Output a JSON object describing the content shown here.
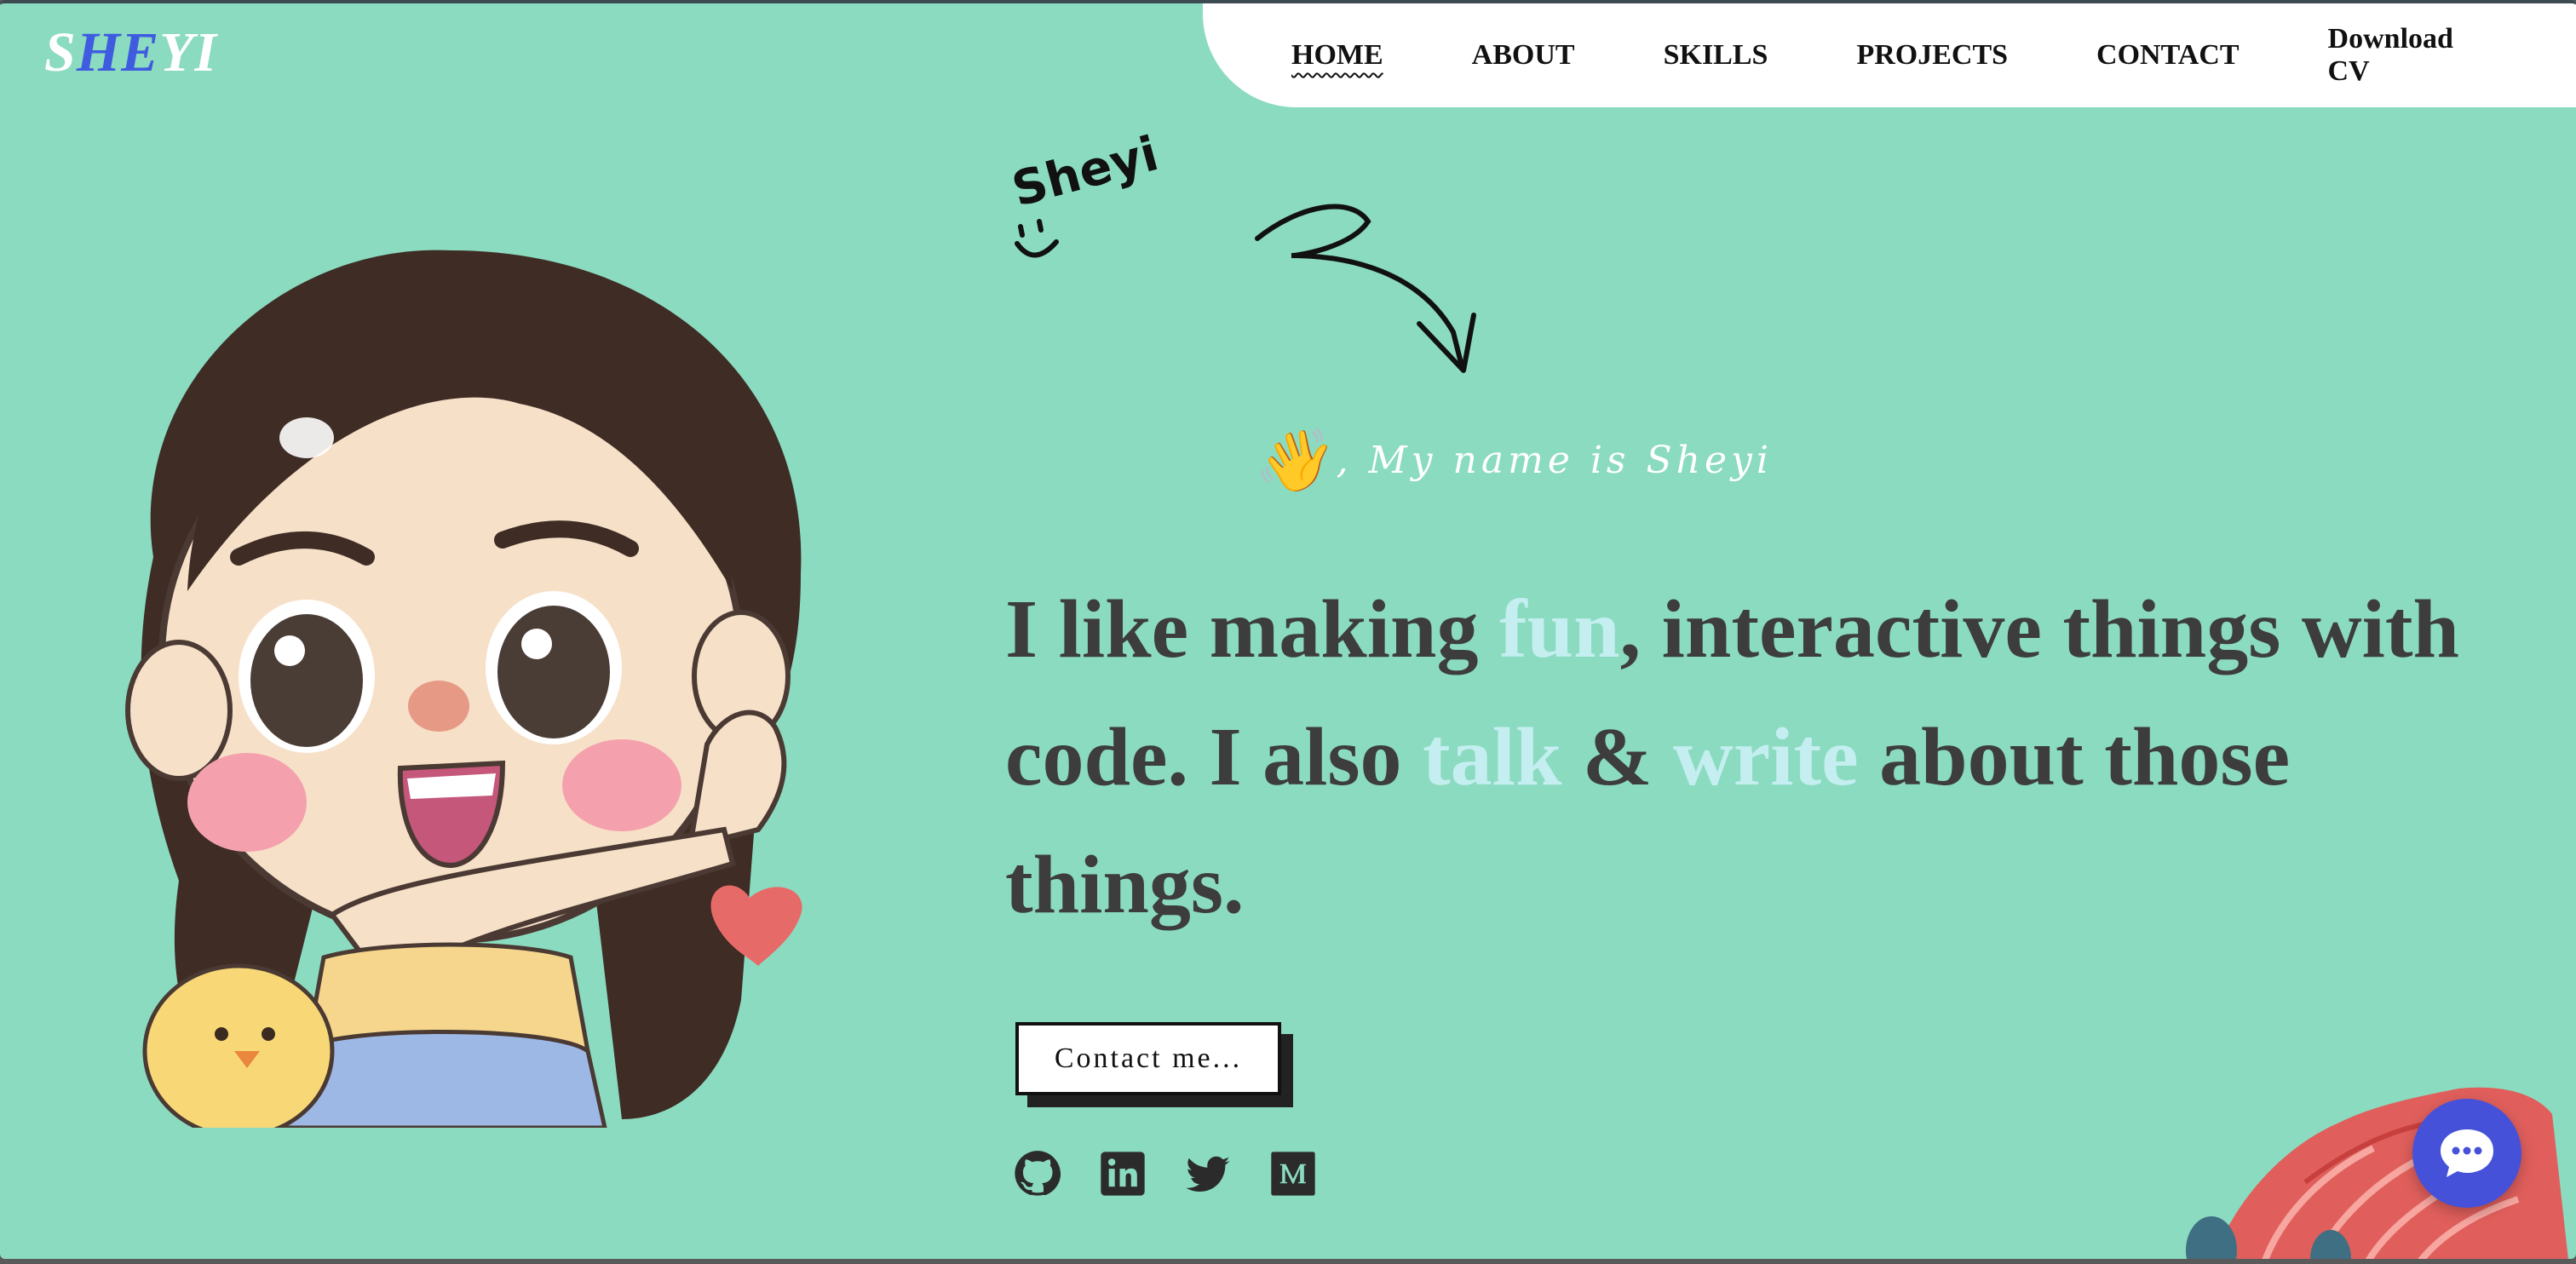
{
  "logo": {
    "letters": [
      {
        "char": "S",
        "color": "#ffffff"
      },
      {
        "char": "H",
        "color": "#3f5bdf"
      },
      {
        "char": "E",
        "color": "#3f5bdf"
      },
      {
        "char": "Y",
        "color": "#ffffff"
      },
      {
        "char": "I",
        "color": "#ffffff"
      }
    ]
  },
  "nav": {
    "items": [
      {
        "label": "HOME",
        "active": true
      },
      {
        "label": "ABOUT"
      },
      {
        "label": "SKILLS"
      },
      {
        "label": "PROJECTS"
      },
      {
        "label": "CONTACT"
      },
      {
        "label": "Download CV"
      }
    ]
  },
  "hero": {
    "handwritten_name": "Sheyi",
    "wave_emoji": "👋",
    "intro": ", My name is Sheyi",
    "headline": {
      "p1": "I like making ",
      "h1": "fun",
      "p2": ", interactive things with code. I also ",
      "h2": "talk",
      "p3": " & ",
      "h3": "write",
      "p4": " about those things."
    },
    "cta_label": "Contact me...",
    "highlight_color": "#c4eef0"
  },
  "socials": [
    {
      "icon": "github-icon"
    },
    {
      "icon": "linkedin-icon"
    },
    {
      "icon": "twitter-icon"
    },
    {
      "icon": "medium-icon"
    }
  ],
  "colors": {
    "background": "#8bdbc0",
    "nav_bg": "#ffffff",
    "text": "#3d3d3d",
    "chat_button": "#4551d9"
  },
  "chat": {
    "icon": "chat-bubble-icon"
  }
}
